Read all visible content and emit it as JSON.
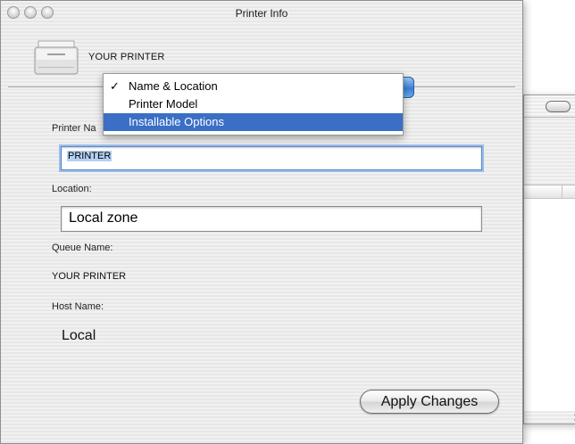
{
  "window": {
    "title": "Printer Info",
    "printer_name": "YOUR PRINTER"
  },
  "menu": {
    "items": [
      {
        "label": "Name & Location",
        "checked": true
      },
      {
        "label": "Printer Model",
        "checked": false
      },
      {
        "label": "Installable Options",
        "checked": false,
        "highlighted": true
      }
    ],
    "check_glyph": "✓"
  },
  "form": {
    "printer_name_label": "Printer Na",
    "printer_name_value": "PRINTER",
    "location_label": "Location:",
    "location_value": "Local zone",
    "queue_label": "Queue Name:",
    "queue_value": "YOUR PRINTER",
    "host_label": "Host Name:",
    "host_value": "Local"
  },
  "buttons": {
    "apply_label": "Apply Changes"
  },
  "colors": {
    "selection": "#3a6fc5",
    "focus_ring": "#9bbdec",
    "text_highlight": "#b5d0f2"
  },
  "icons": {
    "printer": "printer-icon",
    "close": "close-icon",
    "minimize": "minimize-icon",
    "zoom": "zoom-icon",
    "popup_arrows": "popup-arrows-icon",
    "toolbar_toggle": "toolbar-toggle-icon",
    "resize": "resize-grip-icon"
  }
}
